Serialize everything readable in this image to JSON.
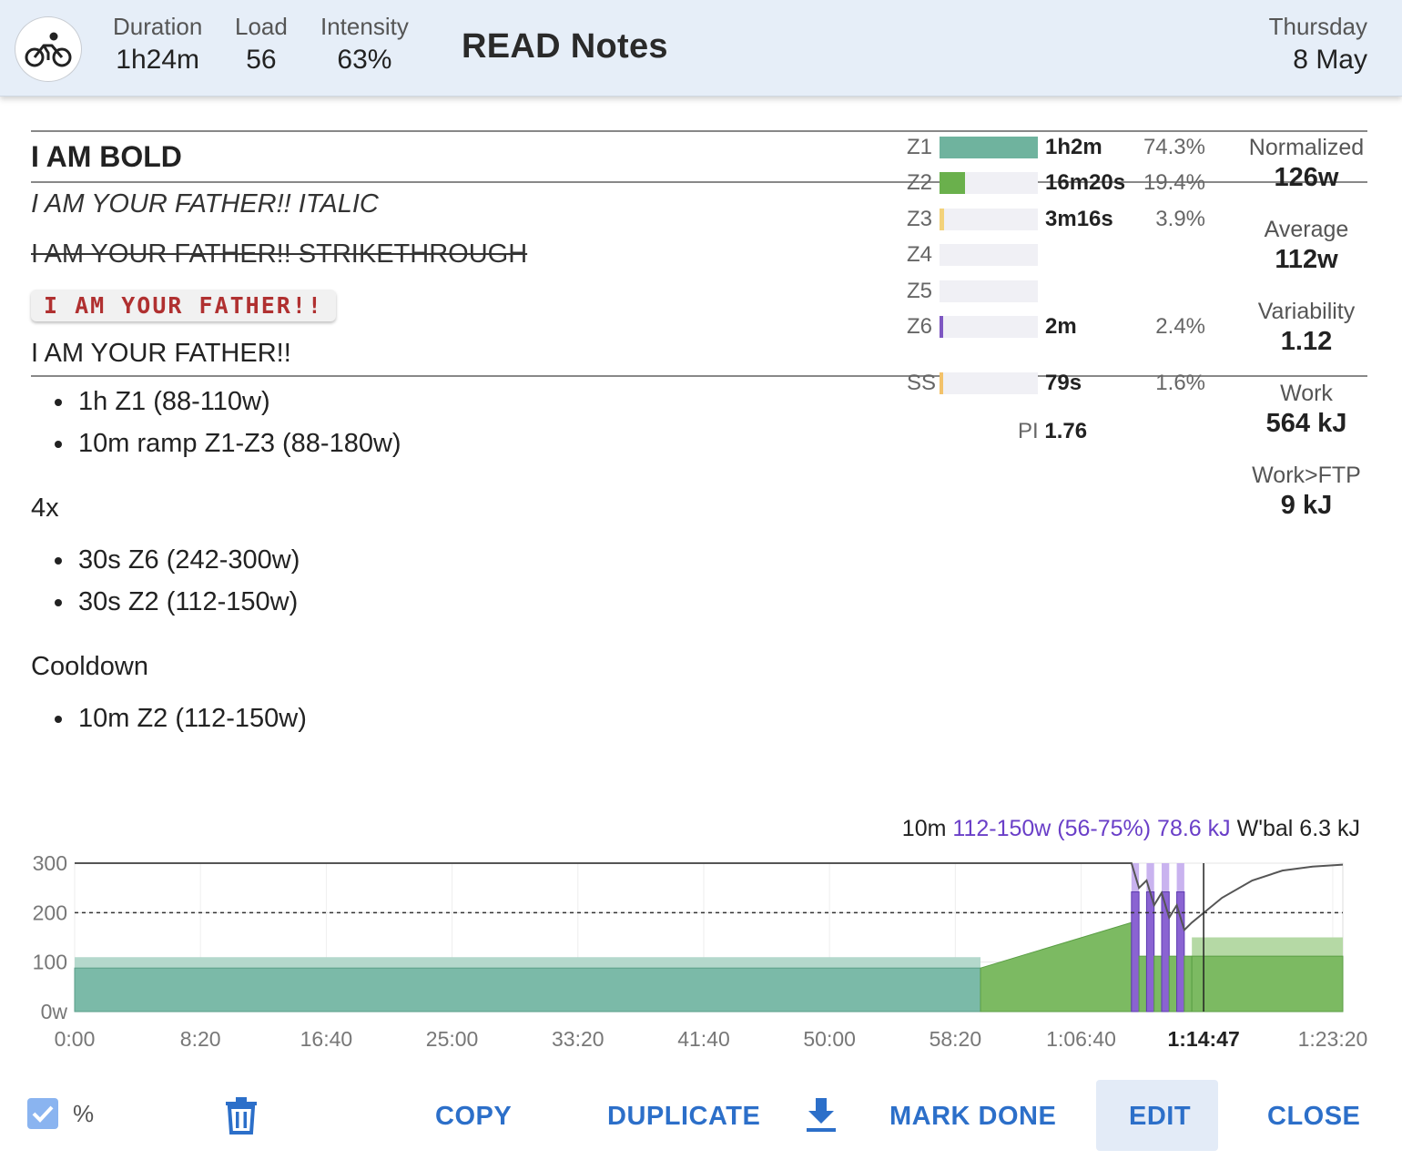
{
  "header": {
    "activity_icon": "bike-icon",
    "stats": [
      {
        "label": "Duration",
        "value": "1h24m"
      },
      {
        "label": "Load",
        "value": "56"
      },
      {
        "label": "Intensity",
        "value": "63%"
      }
    ],
    "title": "READ Notes",
    "day": "Thursday",
    "date": "8 May"
  },
  "notes": {
    "bold": "I AM BOLD",
    "italic": "I AM YOUR FATHER!! ITALIC",
    "strike": "I AM YOUR FATHER!! STRIKETHROUGH",
    "code": "I AM YOUR FATHER!!",
    "plain": "I AM YOUR FATHER!!",
    "list1": [
      "1h Z1 (88-110w)",
      "10m ramp Z1-Z3 (88-180w)"
    ],
    "section2": "4x",
    "list2": [
      "30s Z6 (242-300w)",
      "30s Z2 (112-150w)"
    ],
    "section3": "Cooldown",
    "list3": [
      "10m Z2 (112-150w)"
    ]
  },
  "zones": [
    {
      "name": "Z1",
      "time": "1h2m",
      "pct": "74.3%",
      "fraction": 1.0,
      "color": "#6fb39e"
    },
    {
      "name": "Z2",
      "time": "16m20s",
      "pct": "19.4%",
      "fraction": 0.26,
      "color": "#6ab04c"
    },
    {
      "name": "Z3",
      "time": "3m16s",
      "pct": "3.9%",
      "fraction": 0.05,
      "color": "#f3d27a"
    },
    {
      "name": "Z4",
      "time": "",
      "pct": "",
      "fraction": 0,
      "color": "#e89a4a"
    },
    {
      "name": "Z5",
      "time": "",
      "pct": "",
      "fraction": 0,
      "color": "#e05a4a"
    },
    {
      "name": "Z6",
      "time": "2m",
      "pct": "2.4%",
      "fraction": 0.03,
      "color": "#7e57c2"
    },
    {
      "name": "SS",
      "time": "79s",
      "pct": "1.6%",
      "fraction": 0.02,
      "color": "#f3c26a"
    }
  ],
  "pi": {
    "label": "PI",
    "value": "1.76"
  },
  "metrics": [
    {
      "label": "Normalized",
      "value": "126w"
    },
    {
      "label": "Average",
      "value": "112w"
    },
    {
      "label": "Variability",
      "value": "1.12"
    },
    {
      "label": "Work",
      "value": "564 kJ"
    },
    {
      "label": "Work>FTP",
      "value": "9 kJ"
    }
  ],
  "chart_info": {
    "duration": "10m",
    "power": "112-150w (56-75%) 78.6 kJ",
    "wbal": "W'bal 6.3 kJ"
  },
  "chart_data": {
    "type": "area",
    "ylim": [
      0,
      300
    ],
    "y_ticks": [
      "300",
      "200",
      "100",
      "0w"
    ],
    "x_ticks": [
      "0:00",
      "8:20",
      "16:40",
      "25:00",
      "33:20",
      "41:40",
      "50:00",
      "58:20",
      "1:06:40",
      "1:14:47",
      "1:23:20"
    ],
    "cursor_label": "1:14:47",
    "ftp_line": 200,
    "segments": [
      {
        "name": "Z1",
        "start_min": 0,
        "end_min": 60,
        "low": 88,
        "high": 110
      },
      {
        "name": "ramp Z1-Z3",
        "start_min": 60,
        "end_min": 70,
        "low": 88,
        "high": 180
      },
      {
        "name": "Z6",
        "reps": 4,
        "start_min": 70,
        "interval_s": 30,
        "low": 242,
        "high": 300
      },
      {
        "name": "Z2",
        "reps": 4,
        "interval_s": 30,
        "low": 112,
        "high": 150
      },
      {
        "name": "Cooldown Z2",
        "start_min": 74,
        "end_min": 84,
        "low": 112,
        "high": 150
      }
    ]
  },
  "footer": {
    "percent_label": "%",
    "copy": "COPY",
    "duplicate": "DUPLICATE",
    "mark_done": "MARK DONE",
    "edit": "EDIT",
    "close": "CLOSE"
  }
}
